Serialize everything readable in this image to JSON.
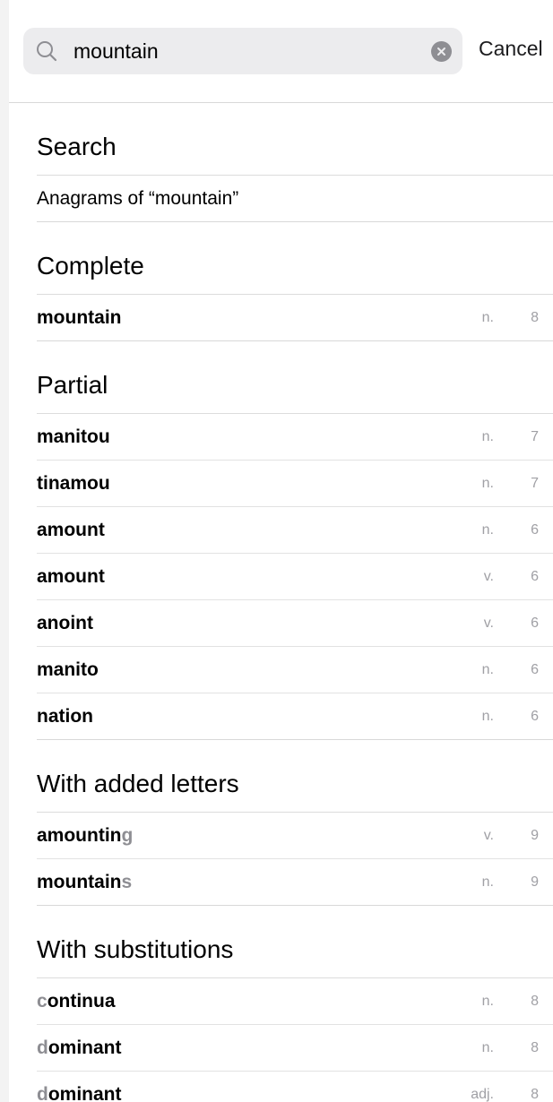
{
  "search": {
    "value": "mountain",
    "placeholder": "",
    "cancel_label": "Cancel"
  },
  "icons": [
    "search-icon",
    "clear-icon"
  ],
  "colors": {
    "field_bg": "#ececee",
    "meta_text": "#a0a0a5",
    "added_letter": "#8e8e93"
  },
  "sections": {
    "search": {
      "title": "Search",
      "rows": [
        {
          "label": "Anagrams of “mountain”"
        }
      ]
    },
    "complete": {
      "title": "Complete",
      "rows": [
        {
          "word": "mountain",
          "pos": "n.",
          "count": "8"
        }
      ]
    },
    "partial": {
      "title": "Partial",
      "rows": [
        {
          "word": "manitou",
          "pos": "n.",
          "count": "7"
        },
        {
          "word": "tinamou",
          "pos": "n.",
          "count": "7"
        },
        {
          "word": "amount",
          "pos": "n.",
          "count": "6"
        },
        {
          "word": "amount",
          "pos": "v.",
          "count": "6"
        },
        {
          "word": "anoint",
          "pos": "v.",
          "count": "6"
        },
        {
          "word": "manito",
          "pos": "n.",
          "count": "6"
        },
        {
          "word": "nation",
          "pos": "n.",
          "count": "6"
        }
      ]
    },
    "added": {
      "title": "With added letters",
      "rows": [
        {
          "base": "amountin",
          "extra": "g",
          "pos": "v.",
          "count": "9"
        },
        {
          "base": "mountain",
          "extra": "s",
          "pos": "n.",
          "count": "9"
        }
      ]
    },
    "substitutions": {
      "title": "With substitutions",
      "rows": [
        {
          "sub": "c",
          "rest": "ontinua",
          "pos": "n.",
          "count": "8"
        },
        {
          "sub": "d",
          "rest": "ominant",
          "pos": "n.",
          "count": "8"
        },
        {
          "sub": "d",
          "rest": "ominant",
          "pos": "adj.",
          "count": "8"
        }
      ]
    }
  }
}
